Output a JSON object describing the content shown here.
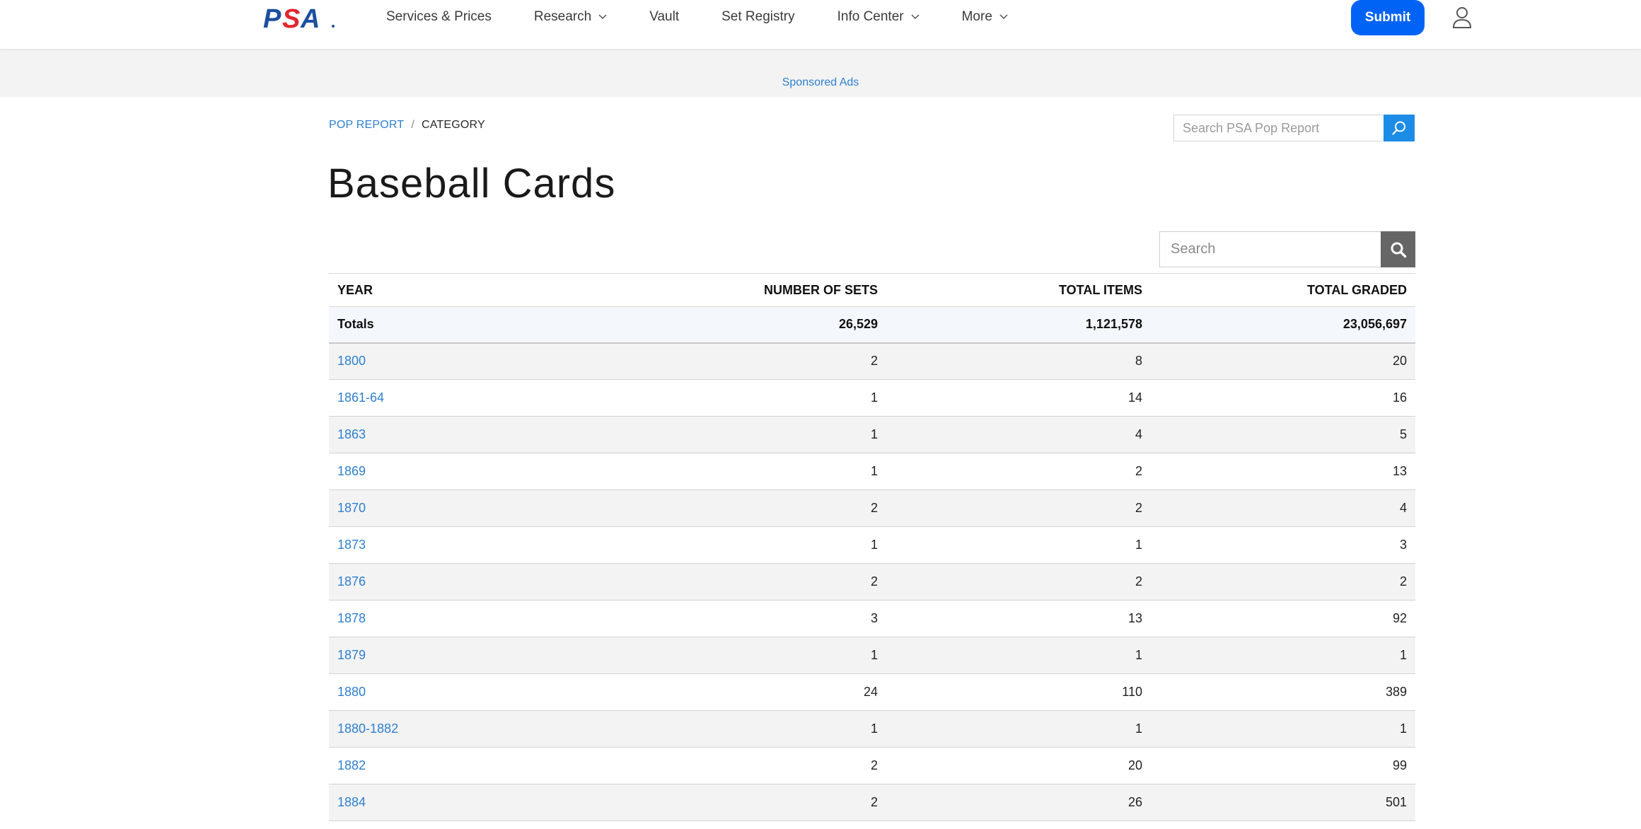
{
  "nav": {
    "items": [
      {
        "label": "Services & Prices",
        "dropdown": false
      },
      {
        "label": "Research",
        "dropdown": true
      },
      {
        "label": "Vault",
        "dropdown": false
      },
      {
        "label": "Set Registry",
        "dropdown": false
      },
      {
        "label": "Info Center",
        "dropdown": true
      },
      {
        "label": "More",
        "dropdown": true
      }
    ],
    "submit_label": "Submit",
    "logo_text": "PSA",
    "accent_color": "#0063f6"
  },
  "ad": {
    "label": "Sponsored Ads"
  },
  "breadcrumb": {
    "root": "POP REPORT",
    "separator": "/",
    "current": "CATEGORY"
  },
  "pop_search": {
    "placeholder": "Search PSA Pop Report"
  },
  "page_title": "Baseball Cards",
  "table_search": {
    "placeholder": "Search"
  },
  "table": {
    "headers": {
      "year": "YEAR",
      "sets": "NUMBER OF SETS",
      "items": "TOTAL ITEMS",
      "graded": "TOTAL GRADED"
    },
    "totals": {
      "label": "Totals",
      "sets": "26,529",
      "items": "1,121,578",
      "graded": "23,056,697"
    },
    "rows": [
      {
        "year": "1800",
        "sets": "2",
        "items": "8",
        "graded": "20"
      },
      {
        "year": "1861-64",
        "sets": "1",
        "items": "14",
        "graded": "16"
      },
      {
        "year": "1863",
        "sets": "1",
        "items": "4",
        "graded": "5"
      },
      {
        "year": "1869",
        "sets": "1",
        "items": "2",
        "graded": "13"
      },
      {
        "year": "1870",
        "sets": "2",
        "items": "2",
        "graded": "4"
      },
      {
        "year": "1873",
        "sets": "1",
        "items": "1",
        "graded": "3"
      },
      {
        "year": "1876",
        "sets": "2",
        "items": "2",
        "graded": "2"
      },
      {
        "year": "1878",
        "sets": "3",
        "items": "13",
        "graded": "92"
      },
      {
        "year": "1879",
        "sets": "1",
        "items": "1",
        "graded": "1"
      },
      {
        "year": "1880",
        "sets": "24",
        "items": "110",
        "graded": "389"
      },
      {
        "year": "1880-1882",
        "sets": "1",
        "items": "1",
        "graded": "1"
      },
      {
        "year": "1882",
        "sets": "2",
        "items": "20",
        "graded": "99"
      },
      {
        "year": "1884",
        "sets": "2",
        "items": "26",
        "graded": "501"
      }
    ]
  }
}
